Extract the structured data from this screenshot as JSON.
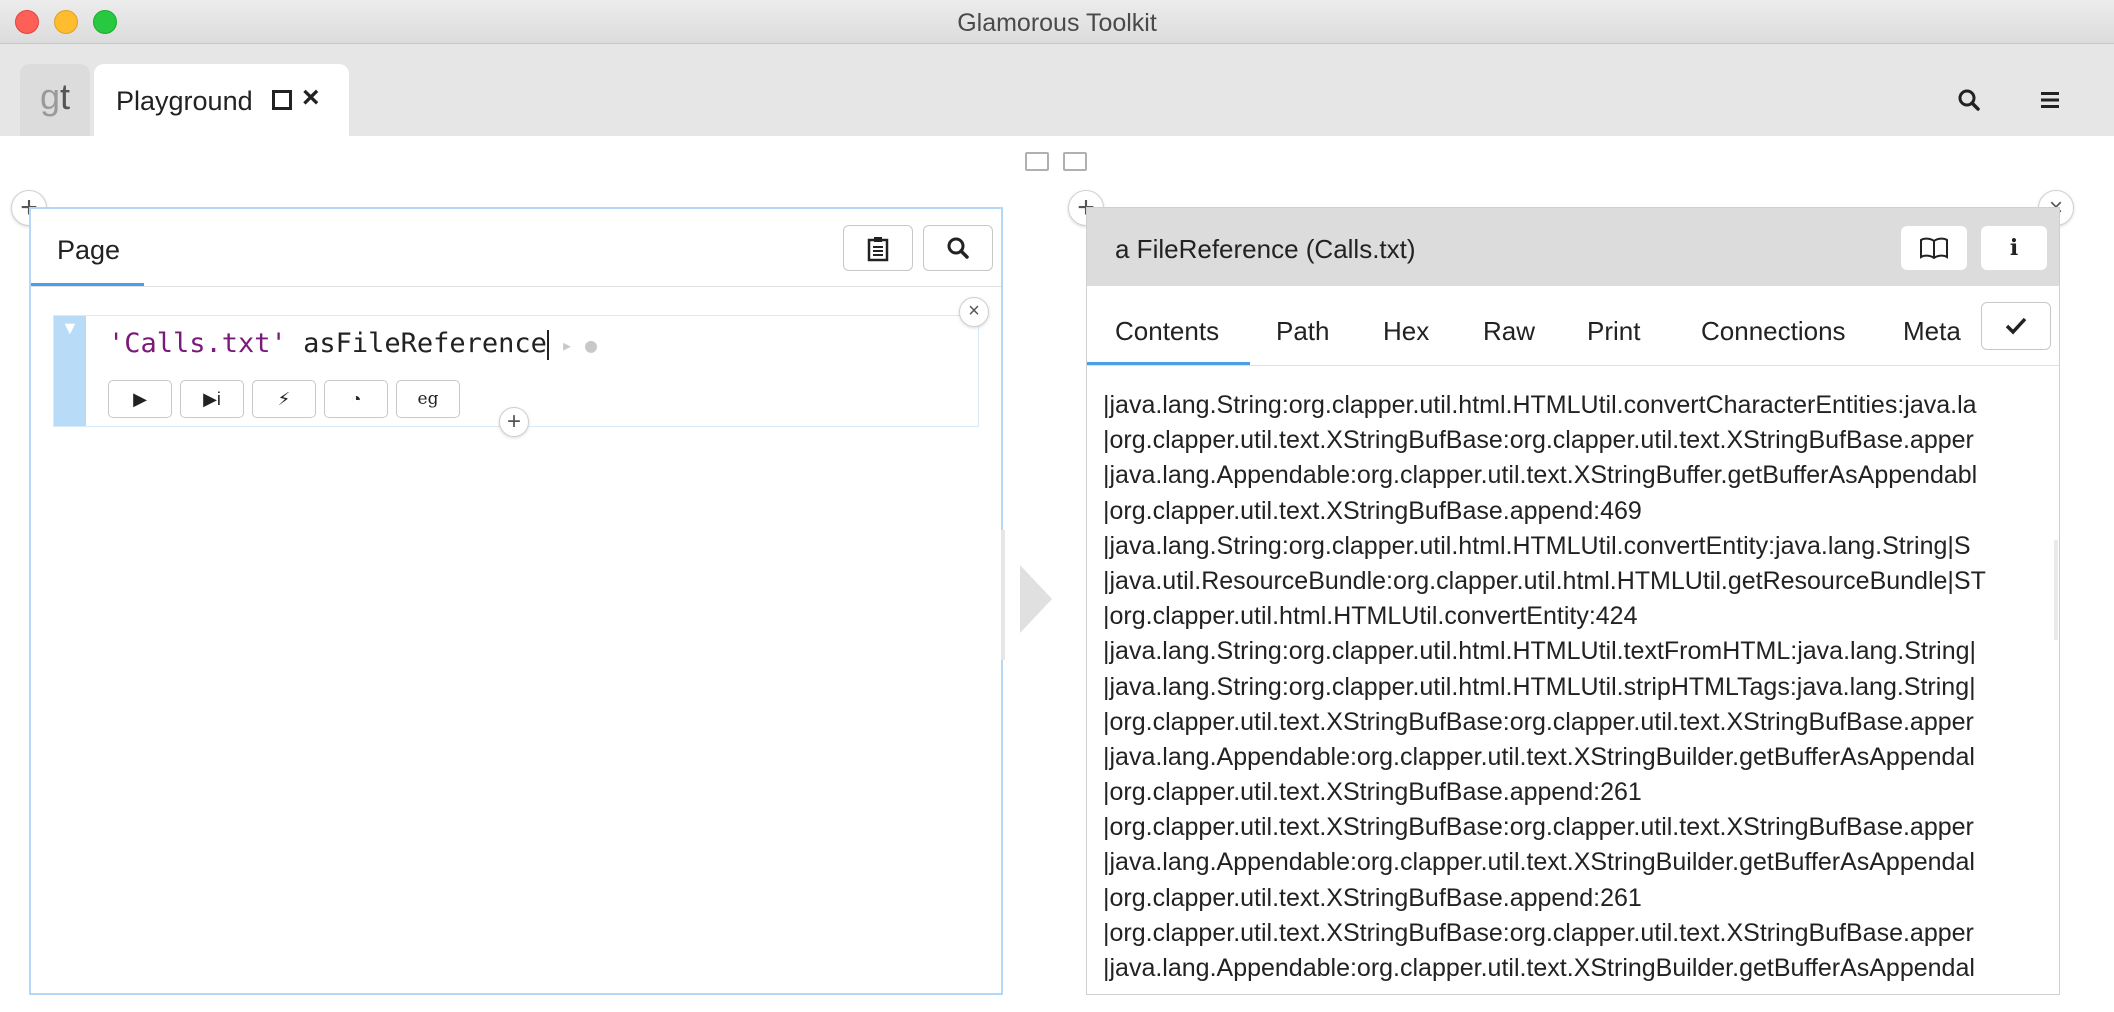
{
  "window": {
    "title": "Glamorous Toolkit"
  },
  "tabbar": {
    "logo_g": "g",
    "logo_t": "t",
    "tab_label": "Playground"
  },
  "left_pane": {
    "page_tab": "Page",
    "snippet": {
      "code_string": "'Calls.txt'",
      "code_message": " asFileReference",
      "buttons": [
        "▶",
        "▶i",
        "⚡",
        "◔",
        "eg"
      ]
    }
  },
  "right_pane": {
    "title": "a FileReference (Calls.txt)",
    "tabs": [
      "Contents",
      "Path",
      "Hex",
      "Raw",
      "Print",
      "Connections",
      "Meta"
    ],
    "selected_tab": "Contents",
    "content_lines": [
      "|java.lang.String:org.clapper.util.html.HTMLUtil.convertCharacterEntities:java.la",
      "|org.clapper.util.text.XStringBufBase:org.clapper.util.text.XStringBufBase.apper",
      "|java.lang.Appendable:org.clapper.util.text.XStringBuffer.getBufferAsAppendabl",
      " |org.clapper.util.text.XStringBufBase.append:469",
      "|java.lang.String:org.clapper.util.html.HTMLUtil.convertEntity:java.lang.String|S",
      "|java.util.ResourceBundle:org.clapper.util.html.HTMLUtil.getResourceBundle|ST",
      " |org.clapper.util.html.HTMLUtil.convertEntity:424",
      "|java.lang.String:org.clapper.util.html.HTMLUtil.textFromHTML:java.lang.String|",
      "|java.lang.String:org.clapper.util.html.HTMLUtil.stripHTMLTags:java.lang.String|",
      "|org.clapper.util.text.XStringBufBase:org.clapper.util.text.XStringBufBase.apper",
      "|java.lang.Appendable:org.clapper.util.text.XStringBuilder.getBufferAsAppendal",
      " |org.clapper.util.text.XStringBufBase.append:261",
      "|org.clapper.util.text.XStringBufBase:org.clapper.util.text.XStringBufBase.apper",
      "|java.lang.Appendable:org.clapper.util.text.XStringBuilder.getBufferAsAppendal",
      " |org.clapper.util.text.XStringBufBase.append:261",
      "|org.clapper.util.text.XStringBufBase:org.clapper.util.text.XStringBufBase.apper",
      "|java.lang.Appendable:org.clapper.util.text.XStringBuilder.getBufferAsAppendal"
    ]
  },
  "colors": {
    "accent": "#4a9fe8",
    "string_literal": "#7a1a7a",
    "pane_border": "#b3d7f5"
  }
}
